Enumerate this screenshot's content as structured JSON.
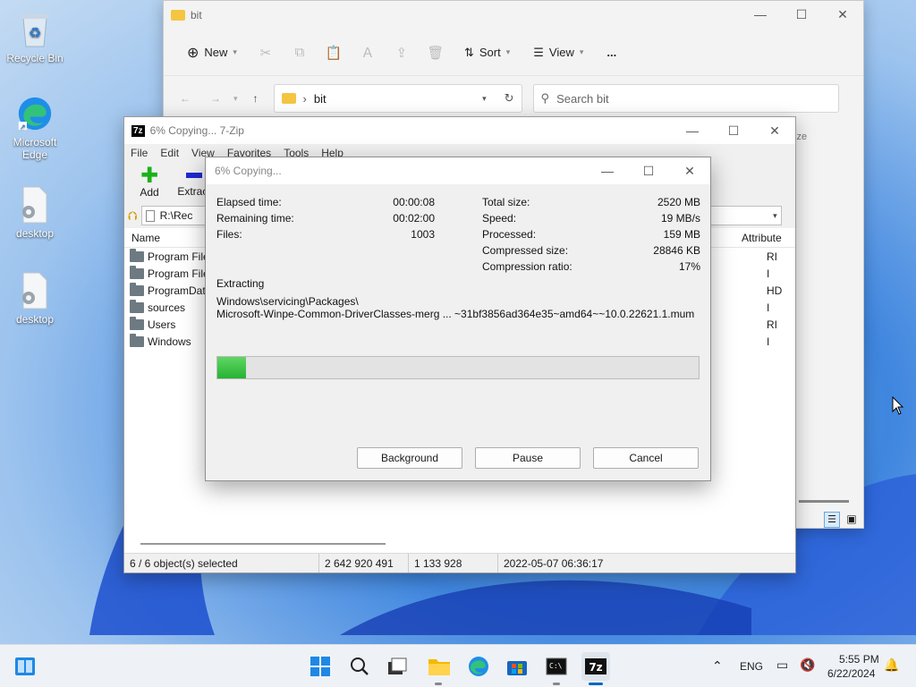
{
  "desktop": {
    "icons": [
      {
        "label": "Recycle Bin"
      },
      {
        "label": "Microsoft Edge"
      },
      {
        "label": "desktop"
      },
      {
        "label": "desktop"
      }
    ]
  },
  "explorer": {
    "title": "bit",
    "toolbar": {
      "new": "New",
      "sort": "Sort",
      "view": "View",
      "more": "..."
    },
    "address": {
      "crumb": "bit",
      "search_placeholder": "Search bit"
    },
    "col_hint": "ize"
  },
  "sevenzip": {
    "title": "6% Copying... 7-Zip",
    "menu": [
      "File",
      "Edit",
      "View",
      "Favorites",
      "Tools",
      "Help"
    ],
    "tools": {
      "add": "Add",
      "extract": "Extract"
    },
    "path": "R:\\Rec",
    "columns": {
      "name": "Name",
      "attributes": "Attribute"
    },
    "rows": [
      {
        "name": "Program File",
        "attr": "RI"
      },
      {
        "name": "Program File",
        "attr": "I"
      },
      {
        "name": "ProgramData",
        "attr": "HD"
      },
      {
        "name": "sources",
        "attr": "I"
      },
      {
        "name": "Users",
        "attr": "RI"
      },
      {
        "name": "Windows",
        "attr": "I"
      }
    ],
    "status": {
      "selected": "6 / 6 object(s) selected",
      "size": "2 642 920 491",
      "packed": "1 133 928",
      "modified": "2022-05-07 06:36:17"
    }
  },
  "dialog": {
    "title": "6% Copying...",
    "left": [
      {
        "label": "Elapsed time:",
        "value": "00:00:08"
      },
      {
        "label": "Remaining time:",
        "value": "00:02:00"
      },
      {
        "label": "Files:",
        "value": "1003"
      }
    ],
    "right": [
      {
        "label": "Total size:",
        "value": "2520 MB"
      },
      {
        "label": "Speed:",
        "value": "19 MB/s"
      },
      {
        "label": "Processed:",
        "value": "159 MB"
      },
      {
        "label": "Compressed size:",
        "value": "28846 KB"
      },
      {
        "label": "Compression ratio:",
        "value": "17%"
      }
    ],
    "operation": "Extracting",
    "path_line1": "Windows\\servicing\\Packages\\",
    "path_line2": "Microsoft-Winpe-Common-DriverClasses-merg ... ~31bf3856ad364e35~amd64~~10.0.22621.1.mum",
    "progress_fraction": 0.06,
    "buttons": {
      "background": "Background",
      "pause": "Pause",
      "cancel": "Cancel"
    }
  },
  "taskbar": {
    "lang": "ENG",
    "time": "5:55 PM",
    "date": "6/22/2024"
  },
  "colors": {
    "accent": "#0067c0",
    "progress": "#27b232"
  }
}
